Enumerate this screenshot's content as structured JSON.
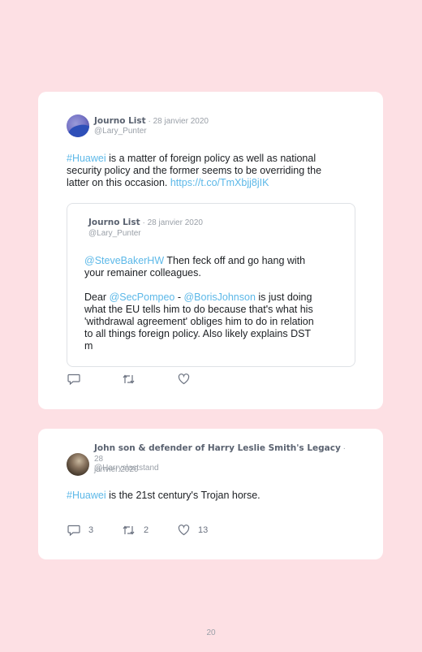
{
  "tweet1": {
    "name": "Journo List",
    "date": " · 28 janvier 2020",
    "handle": "@Lary_Punter",
    "hashtag": "#Huawei",
    "text_line1_rest": " is a matter of foreign policy as well as national",
    "text_line2": "security policy and the former seems to be overriding the",
    "text_line3": "latter on this occasion. ",
    "link": "https://t.co/TmXbjj8jIK",
    "quote": {
      "name": "Journo List",
      "date": " · 28 janvier 2020",
      "handle": "@Lary_Punter",
      "mention1": "@SteveBakerHW",
      "p1_rest": " Then feck off and go hang with",
      "p1_line2": "your remainer colleagues.",
      "p2_start": "Dear ",
      "mention2": "@SecPompeo",
      "p2_mid": " - ",
      "mention3": "@BorisJohnson",
      "p2_rest": " is just doing",
      "p2_line2": "what the EU tells him to do because that's what his",
      "p2_line3": "'withdrawal agreement' obliges him to do in relation",
      "p2_line4": "to all things foreign policy. Also likely explains DST",
      "p2_line5": "m"
    },
    "actions": {
      "reply_icon": "reply-icon",
      "retweet_icon": "retweet-icon",
      "like_icon": "heart-icon"
    }
  },
  "tweet2": {
    "name": "John son & defender of Harry Leslie Smith's Legacy",
    "date_part1": " · 28",
    "date_part2": "janvier 2020",
    "handle": "@Harryslaststand",
    "hashtag": "#Huawei",
    "text_rest": " is the 21st century's Trojan horse.",
    "replies": "3",
    "retweets": "2",
    "likes": "13"
  },
  "page_number": "20"
}
